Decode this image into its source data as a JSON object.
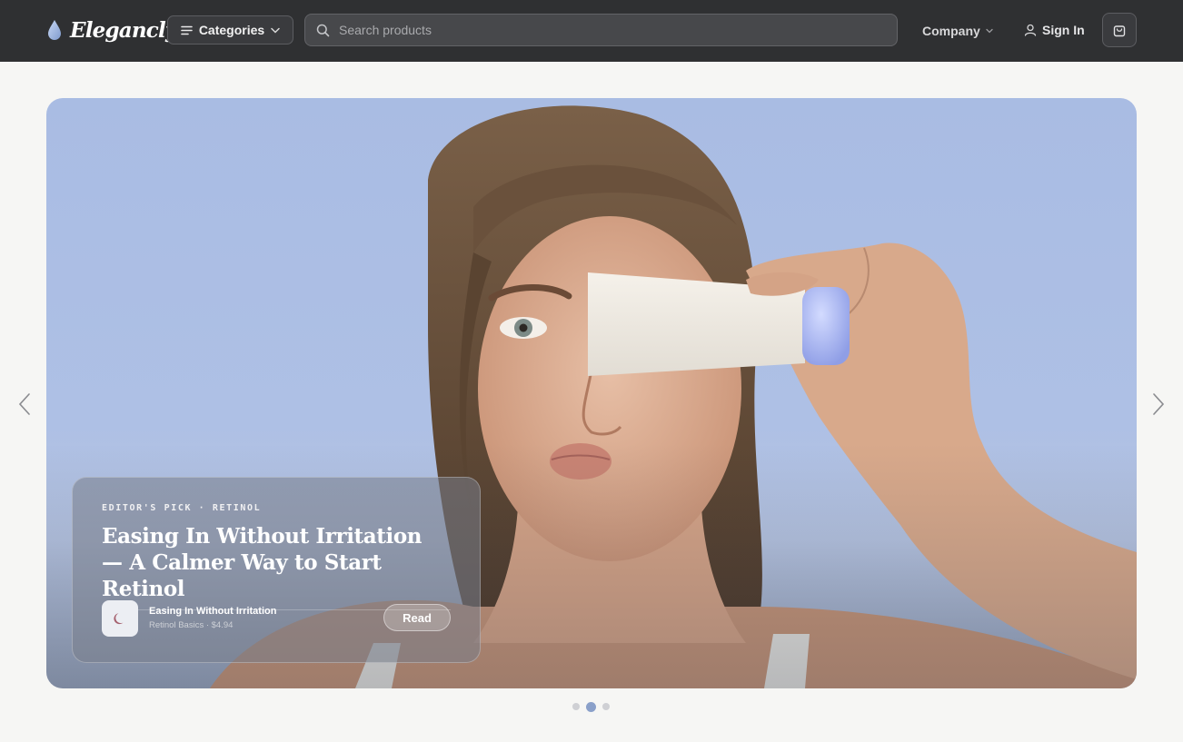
{
  "brand": {
    "name": "Elegancly"
  },
  "nav": {
    "categories_label": "Categories",
    "search_placeholder": "Search products",
    "company_label": "Company",
    "signin_label": "Sign In"
  },
  "hero": {
    "eyebrow": "EDITOR'S PICK · RETINOL",
    "headline": "Easing In Without Irritation — A Calmer Way to Start Retinol",
    "product": {
      "name": "Easing In Without Irritation",
      "meta": "Retinol Basics · $4.94",
      "icon": "moon-icon"
    },
    "cta_label": "Read"
  },
  "carousel": {
    "slides": 3,
    "active_index": 2
  },
  "colors": {
    "topbar": "#2f3032",
    "page_bg": "#f6f6f4",
    "accent_dot": "#8aa0c9",
    "tube_cap": "#a9b6ee"
  }
}
